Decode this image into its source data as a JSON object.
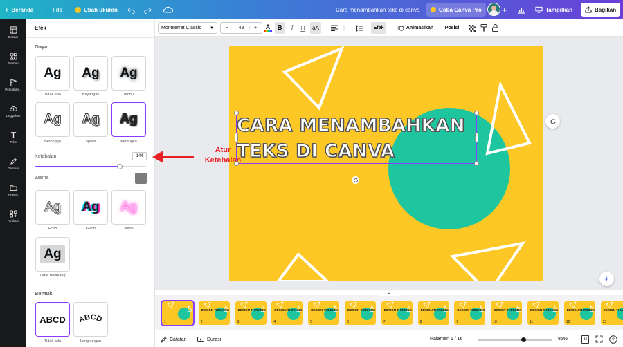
{
  "topbar": {
    "home": "Beranda",
    "file": "File",
    "resize": "Ubah ukuran",
    "doc_title": "Cara menambahkan teks di canva",
    "pro": "Coba Canva Pro",
    "present": "Tampilkan",
    "share": "Bagikan"
  },
  "rail": [
    {
      "label": "Desain",
      "icon": "layout-icon"
    },
    {
      "label": "Elemen",
      "icon": "shapes-icon"
    },
    {
      "label": "Pengiklan...",
      "icon": "brand-icon"
    },
    {
      "label": "Unggahan",
      "icon": "upload-icon"
    },
    {
      "label": "Teks",
      "icon": "text-icon"
    },
    {
      "label": "Gambar",
      "icon": "draw-icon"
    },
    {
      "label": "Proyek",
      "icon": "folder-icon"
    },
    {
      "label": "Aplikasi",
      "icon": "apps-icon"
    }
  ],
  "panel": {
    "title": "Efek",
    "style_heading": "Gaya",
    "styles": [
      {
        "label": "Tidak ada",
        "text": "Ag"
      },
      {
        "label": "Bayangan",
        "text": "Ag"
      },
      {
        "label": "Timbul",
        "text": "Ag"
      },
      {
        "label": "Berongga",
        "text": "Ag"
      },
      {
        "label": "Splice",
        "text": "Ag"
      },
      {
        "label": "Kerangka",
        "text": "Ag"
      }
    ],
    "thickness_label": "Ketebalan",
    "thickness_value": "144",
    "thickness_fraction": 0.76,
    "color_label": "Warna",
    "color_value": "#7b7b7b",
    "styles2": [
      {
        "label": "Echo",
        "text": "Ag"
      },
      {
        "label": "Glitch",
        "text": "Ag"
      },
      {
        "label": "Neon",
        "text": "Ag"
      },
      {
        "label": "Latar Belakang",
        "text": "Ag"
      }
    ],
    "shape_heading": "Bentuk",
    "shapes": [
      {
        "label": "Tidak ada",
        "text": "ABCD"
      },
      {
        "label": "Lengkungan",
        "text": "ABCD"
      }
    ]
  },
  "toolbar": {
    "font": "Montserrat Classic",
    "font_size": "48",
    "effects": "Efek",
    "animate": "Animasikan",
    "position": "Posisi"
  },
  "canvas": {
    "line1": "CARA MENAMBAHKAN",
    "line2": "TEKS DI CANVA",
    "bg_color": "#fdc726",
    "circle_color": "#1ec6a0"
  },
  "annotation": {
    "line1": "Atur",
    "line2": "Ketebalan"
  },
  "thumbs": {
    "text": "DESIGN THINKING",
    "numbers": [
      "1",
      "2",
      "3",
      "4",
      "5",
      "6",
      "7",
      "8",
      "9",
      "10",
      "11",
      "12",
      "13"
    ]
  },
  "bottombar": {
    "notes": "Catatan",
    "duration": "Durasi",
    "page": "Halaman 1 / 16",
    "zoom": "85%",
    "zoom_fraction": 0.62,
    "pages_badge": "16"
  }
}
